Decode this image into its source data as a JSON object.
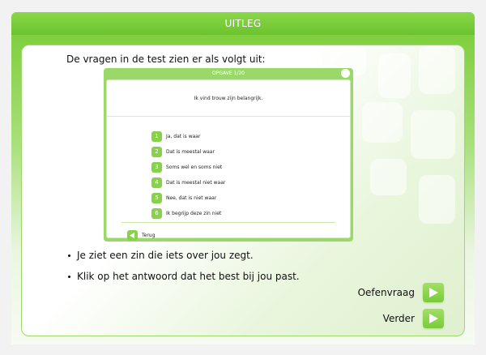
{
  "header": {
    "title": "UITLEG"
  },
  "intro": "De vragen in de test zien er als volgt uit:",
  "example": {
    "title": "OPGAVE 1/20",
    "question": "Ik vind trouw zijn belangrijk.",
    "options": [
      {
        "num": "1",
        "label": "Ja, dat is waar"
      },
      {
        "num": "2",
        "label": "Dat is meestal waar"
      },
      {
        "num": "3",
        "label": "Soms wel en soms niet"
      },
      {
        "num": "4",
        "label": "Dat is meestal niet waar"
      },
      {
        "num": "5",
        "label": "Nee, dat is niet waar"
      },
      {
        "num": "6",
        "label": "Ik begrijp deze zin niet"
      }
    ],
    "back_label": "Terug"
  },
  "bullets": [
    "Je ziet een zin die iets over jou zegt.",
    "Klik op het antwoord dat het best bij jou past."
  ],
  "actions": {
    "practice_label": "Oefenvraag",
    "next_label": "Verder"
  },
  "colors": {
    "accent": "#7ccf3c",
    "panel_border": "#9ed86a"
  }
}
